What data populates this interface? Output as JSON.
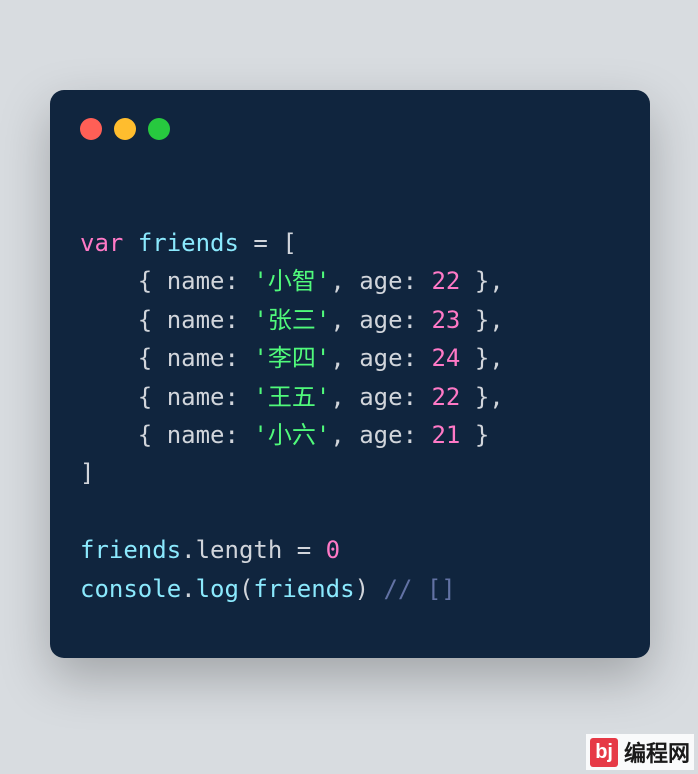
{
  "code": {
    "varKeyword": "var",
    "varName": "friends",
    "entries": [
      {
        "name": "'小智'",
        "age": "22"
      },
      {
        "name": "'张三'",
        "age": "23"
      },
      {
        "name": "'李四'",
        "age": "24"
      },
      {
        "name": "'王五'",
        "age": "22"
      },
      {
        "name": "'小六'",
        "age": "21"
      }
    ],
    "nameKey": "name",
    "ageKey": "age",
    "line2a": "friends",
    "line2b": "length",
    "line2c": "0",
    "line3a": "console",
    "line3b": "log",
    "line3c": "friends",
    "line3d": "// []"
  },
  "watermark": {
    "badge": "bj",
    "text": "编程网"
  }
}
